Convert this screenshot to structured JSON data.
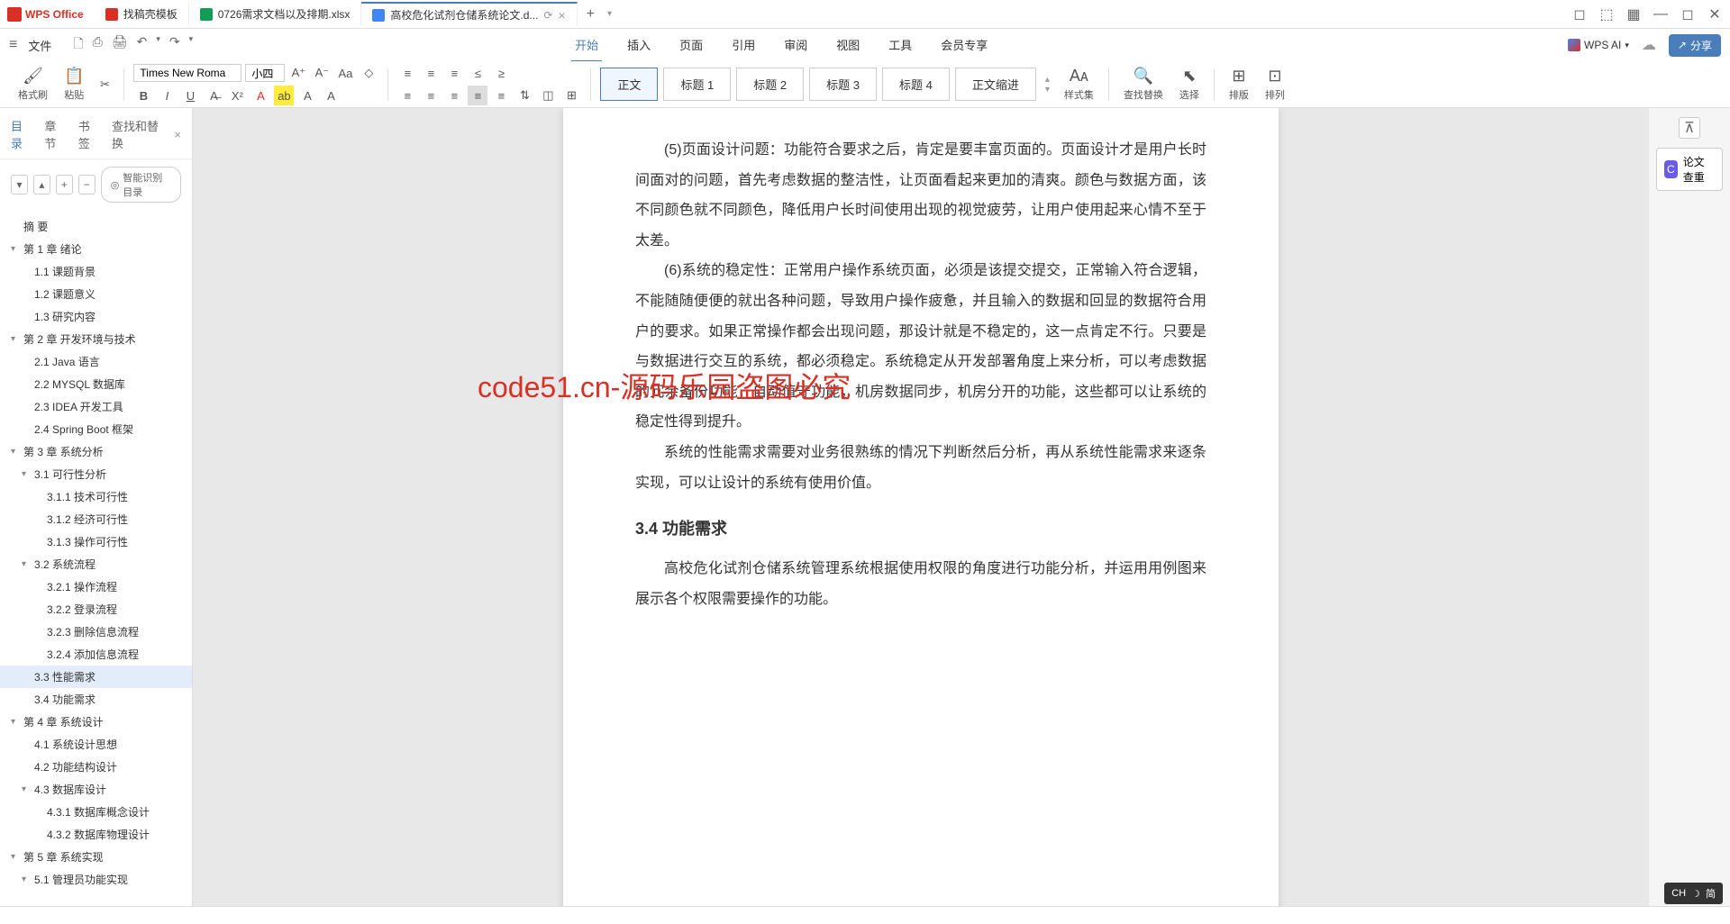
{
  "app": {
    "name": "WPS Office"
  },
  "tabs": [
    {
      "label": "找稿壳模板",
      "icon": "red"
    },
    {
      "label": "0726需求文档以及排期.xlsx",
      "icon": "green"
    },
    {
      "label": "高校危化试剂仓储系统论文.d...",
      "icon": "blue",
      "active": true
    }
  ],
  "file_menu": "文件",
  "menu_tabs": [
    "开始",
    "插入",
    "页面",
    "引用",
    "审阅",
    "视图",
    "工具",
    "会员专享"
  ],
  "wps_ai": "WPS AI",
  "share": "分享",
  "ribbon": {
    "format_painter": "格式刷",
    "paste": "粘贴",
    "font": "Times New Roma",
    "size": "小四",
    "body_text": "正文",
    "heading1": "标题 1",
    "heading2": "标题 2",
    "heading3": "标题 3",
    "heading4": "标题 4",
    "body_indent": "正文缩进",
    "styles": "样式集",
    "find": "查找替换",
    "select": "选择",
    "sort": "排版",
    "arrange": "排列"
  },
  "sidebar": {
    "tabs": [
      "目录",
      "章节",
      "书签",
      "查找和替换"
    ],
    "smart": "智能识别目录",
    "outline": [
      {
        "label": "摘 要",
        "level": 0
      },
      {
        "label": "第 1 章  绪论",
        "level": 0,
        "arrow": true
      },
      {
        "label": "1.1  课题背景",
        "level": 1
      },
      {
        "label": "1.2  课题意义",
        "level": 1
      },
      {
        "label": "1.3  研究内容",
        "level": 1
      },
      {
        "label": "第 2 章  开发环境与技术",
        "level": 0,
        "arrow": true
      },
      {
        "label": "2.1 Java 语言",
        "level": 1
      },
      {
        "label": "2.2 MYSQL 数据库",
        "level": 1
      },
      {
        "label": "2.3 IDEA 开发工具",
        "level": 1
      },
      {
        "label": "2.4 Spring Boot 框架",
        "level": 1
      },
      {
        "label": "第 3 章  系统分析",
        "level": 0,
        "arrow": true
      },
      {
        "label": "3.1  可行性分析",
        "level": 1,
        "arrow": true
      },
      {
        "label": "3.1.1  技术可行性",
        "level": 2
      },
      {
        "label": "3.1.2  经济可行性",
        "level": 2
      },
      {
        "label": "3.1.3  操作可行性",
        "level": 2
      },
      {
        "label": "3.2  系统流程",
        "level": 1,
        "arrow": true
      },
      {
        "label": "3.2.1  操作流程",
        "level": 2
      },
      {
        "label": "3.2.2  登录流程",
        "level": 2
      },
      {
        "label": "3.2.3  删除信息流程",
        "level": 2
      },
      {
        "label": "3.2.4  添加信息流程",
        "level": 2
      },
      {
        "label": "3.3  性能需求",
        "level": 1,
        "selected": true
      },
      {
        "label": "3.4  功能需求",
        "level": 1
      },
      {
        "label": "第 4 章  系统设计",
        "level": 0,
        "arrow": true
      },
      {
        "label": "4.1  系统设计思想",
        "level": 1
      },
      {
        "label": "4.2  功能结构设计",
        "level": 1
      },
      {
        "label": "4.3  数据库设计",
        "level": 1,
        "arrow": true
      },
      {
        "label": "4.3.1  数据库概念设计",
        "level": 2
      },
      {
        "label": "4.3.2  数据库物理设计",
        "level": 2
      },
      {
        "label": "第 5 章  系统实现",
        "level": 0,
        "arrow": true
      },
      {
        "label": "5.1  管理员功能实现",
        "level": 1,
        "arrow": true
      }
    ]
  },
  "document": {
    "p1": "(5)页面设计问题：功能符合要求之后，肯定是要丰富页面的。页面设计才是用户长时间面对的问题，首先考虑数据的整洁性，让页面看起来更加的清爽。颜色与数据方面，该不同颜色就不同颜色，降低用户长时间使用出现的视觉疲劳，让用户使用起来心情不至于太差。",
    "p2": "(6)系统的稳定性：正常用户操作系统页面，必须是该提交提交，正常输入符合逻辑，不能随随便便的就出各种问题，导致用户操作疲惫，并且输入的数据和回显的数据符合用户的要求。如果正常操作都会出现问题，那设计就是不稳定的，这一点肯定不行。只要是与数据进行交互的系统，都必须稳定。系统稳定从开发部署角度上来分析，可以考虑数据的冗余备份功能，自动值守功能，机房数据同步，机房分开的功能，这些都可以让系统的稳定性得到提升。",
    "p3": "系统的性能需求需要对业务很熟练的情况下判断然后分析，再从系统性能需求来逐条实现，可以让设计的系统有使用价值。",
    "h1": "3.4  功能需求",
    "p4": "高校危化试剂仓储系统管理系统根据使用权限的角度进行功能分析，并运用用例图来展示各个权限需要操作的功能。"
  },
  "right": {
    "check": "论文查重"
  },
  "ime": {
    "lang": "CH",
    "mode": "简"
  },
  "watermark": "code51.cn",
  "watermark_red": "code51.cn-源码乐园盗图必究"
}
